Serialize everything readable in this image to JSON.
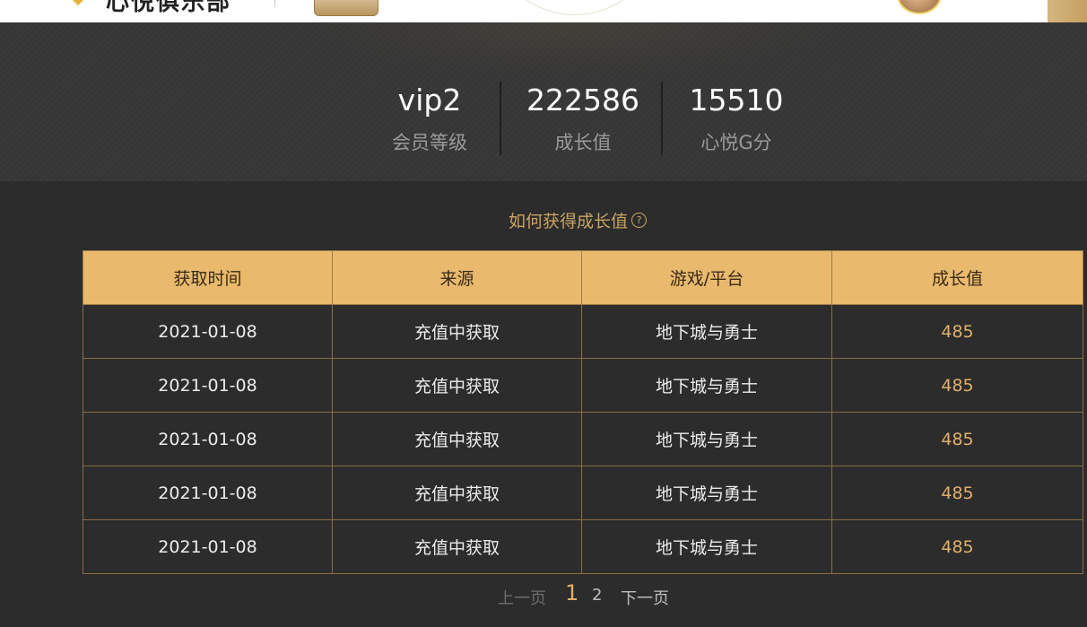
{
  "header": {
    "title": "心悦俱乐部"
  },
  "stats": [
    {
      "value": "vip2",
      "label": "会员等级"
    },
    {
      "value": "222586",
      "label": "成长值"
    },
    {
      "value": "15510",
      "label": "心悦G分"
    }
  ],
  "how_to_link": "如何获得成长值",
  "help_icon": "question-circle-icon",
  "table": {
    "columns": [
      "获取时间",
      "来源",
      "游戏/平台",
      "成长值"
    ],
    "rows": [
      [
        "2021-01-08",
        "充值中获取",
        "地下城与勇士",
        "485"
      ],
      [
        "2021-01-08",
        "充值中获取",
        "地下城与勇士",
        "485"
      ],
      [
        "2021-01-08",
        "充值中获取",
        "地下城与勇士",
        "485"
      ],
      [
        "2021-01-08",
        "充值中获取",
        "地下城与勇士",
        "485"
      ],
      [
        "2021-01-08",
        "充值中获取",
        "地下城与勇士",
        "485"
      ]
    ]
  },
  "pagination": {
    "prev": "上一页",
    "pages": [
      "1",
      "2"
    ],
    "current": "1",
    "next": "下一页"
  },
  "colors": {
    "accent": "#e9b96e",
    "background": "#2c2c2c",
    "value_text": "#e0b06a"
  }
}
